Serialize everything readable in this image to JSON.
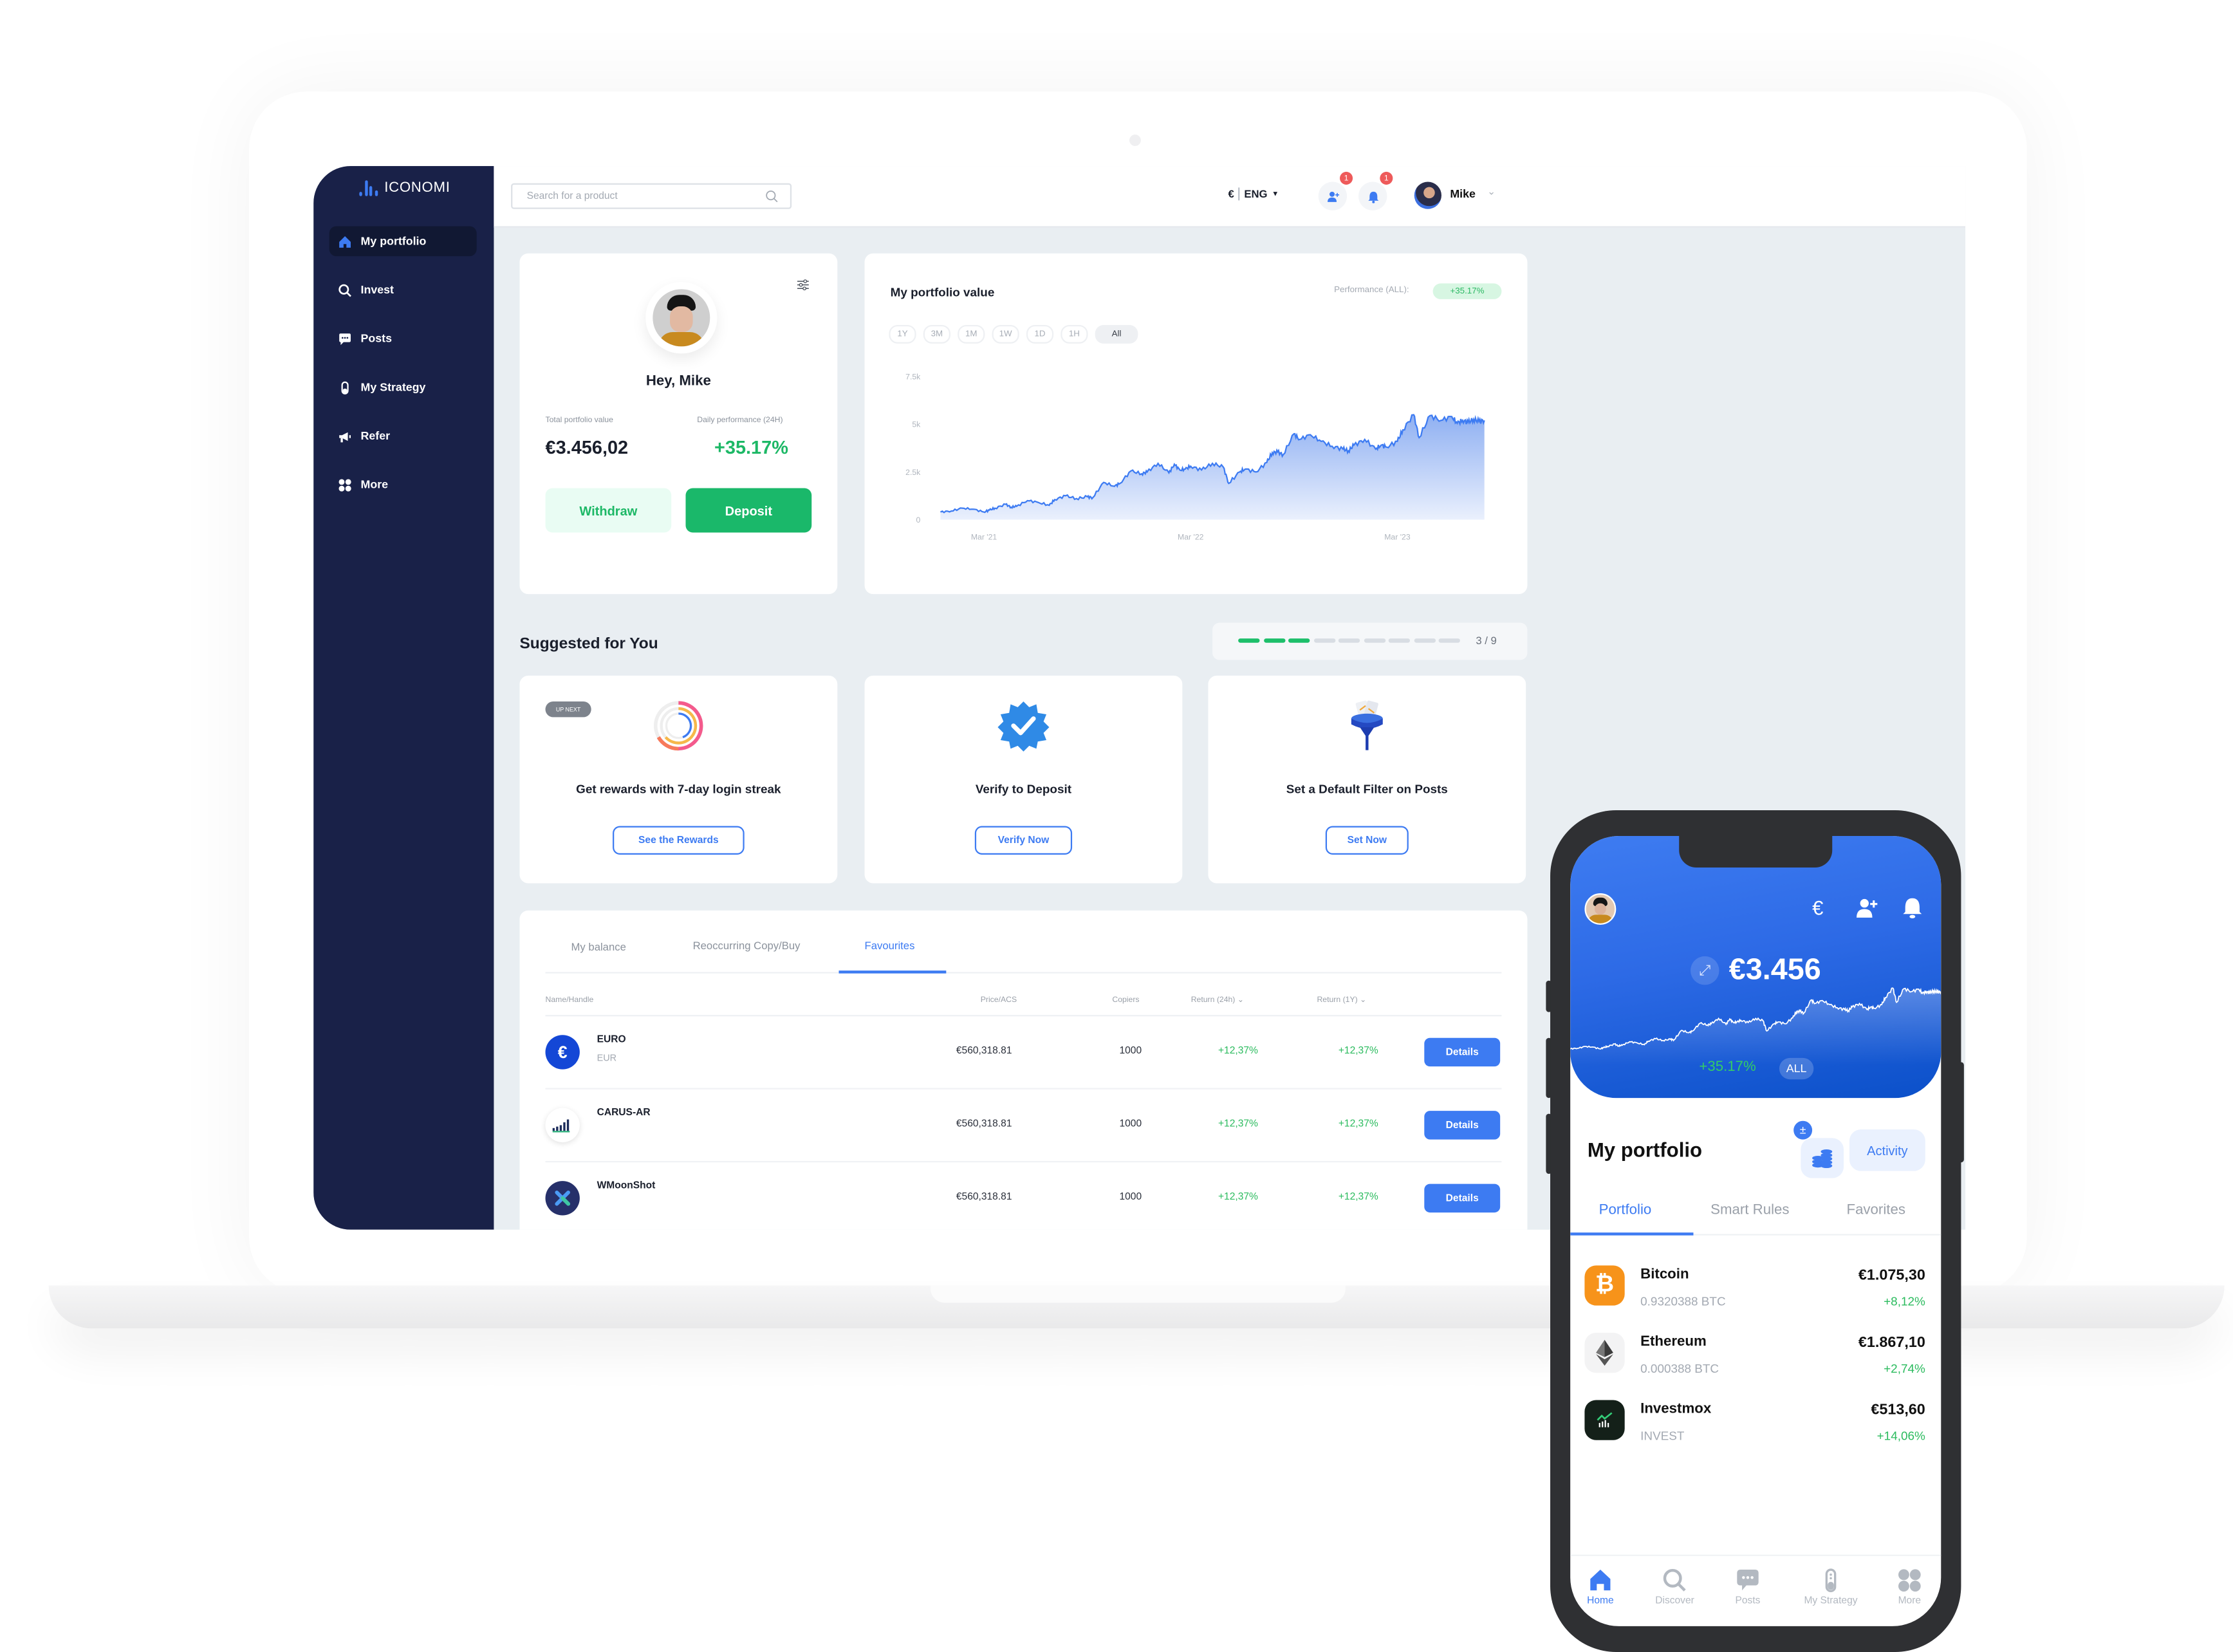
{
  "app": {
    "brand": "ICONOMI",
    "colors": {
      "primary": "#3d7bf2",
      "sidebar": "#192148",
      "success": "#1ab86a",
      "danger": "#ee5a5a",
      "background": "#e9eef2"
    }
  },
  "sidebar": {
    "items": [
      {
        "label": "My portfolio",
        "icon": "home-icon",
        "active": true
      },
      {
        "label": "Invest",
        "icon": "search-icon",
        "active": false
      },
      {
        "label": "Posts",
        "icon": "chat-icon",
        "active": false
      },
      {
        "label": "My Strategy",
        "icon": "flask-icon",
        "active": false
      },
      {
        "label": "Refer",
        "icon": "megaphone-icon",
        "active": false
      },
      {
        "label": "More",
        "icon": "grid-icon",
        "active": false
      }
    ]
  },
  "topbar": {
    "search_placeholder": "Search for a product",
    "currency": "€",
    "language": "ENG",
    "invites_badge": "1",
    "notifications_badge": "1",
    "user_name": "Mike"
  },
  "profile": {
    "greeting": "Hey, Mike",
    "total_label": "Total portfolio value",
    "total_value": "€3.456,02",
    "daily_label": "Daily performance (24H)",
    "daily_value": "+35.17%",
    "withdraw_label": "Withdraw",
    "deposit_label": "Deposit"
  },
  "portfolio_chart": {
    "title": "My portfolio value",
    "performance_label": "Performance (ALL):",
    "performance_value": "+35.17%",
    "ranges": [
      "1Y",
      "3M",
      "1M",
      "1W",
      "1D",
      "1H",
      "All"
    ],
    "active_range": "All"
  },
  "chart_data": {
    "type": "area",
    "title": "My portfolio value",
    "xlabel": "",
    "ylabel": "",
    "ylim": [
      0,
      7500
    ],
    "yticks": [
      "0",
      "2.5k",
      "5k",
      "7.5k"
    ],
    "ytick_values": [
      0,
      2500,
      5000,
      7500
    ],
    "xticks": [
      "Mar '21",
      "Mar '22",
      "Mar '23"
    ],
    "xtick_positions": [
      0.08,
      0.46,
      0.84
    ],
    "grid": false,
    "series": [
      {
        "name": "Portfolio value",
        "x": [
          0,
          0.02,
          0.04,
          0.06,
          0.08,
          0.09,
          0.1,
          0.12,
          0.13,
          0.14,
          0.16,
          0.18,
          0.2,
          0.21,
          0.23,
          0.25,
          0.27,
          0.28,
          0.3,
          0.32,
          0.33,
          0.35,
          0.37,
          0.38,
          0.4,
          0.42,
          0.43,
          0.44,
          0.45,
          0.46,
          0.48,
          0.5,
          0.52,
          0.53,
          0.55,
          0.56,
          0.58,
          0.6,
          0.61,
          0.62,
          0.63,
          0.65,
          0.66,
          0.68,
          0.7,
          0.72,
          0.74,
          0.75,
          0.76,
          0.78,
          0.8,
          0.81,
          0.82,
          0.84,
          0.85,
          0.87,
          0.88,
          0.9,
          0.92,
          0.94,
          0.95,
          0.96,
          0.97,
          0.98,
          0.99,
          1.0
        ],
        "values": [
          400,
          450,
          600,
          550,
          400,
          500,
          600,
          800,
          650,
          700,
          1000,
          900,
          750,
          1050,
          1250,
          1100,
          1200,
          1150,
          1950,
          1750,
          1900,
          2550,
          2400,
          2500,
          2950,
          2450,
          2900,
          2600,
          2650,
          2800,
          2600,
          2950,
          2750,
          1900,
          2500,
          2650,
          2500,
          3000,
          3500,
          3550,
          3400,
          4500,
          4200,
          4450,
          4100,
          3850,
          3700,
          3600,
          3900,
          4200,
          3700,
          3900,
          3800,
          4100,
          4700,
          5500,
          4300,
          5450,
          5200,
          5400,
          5050,
          5200,
          5100,
          5250,
          5150,
          5200
        ]
      }
    ]
  },
  "suggested": {
    "title": "Suggested for You",
    "progress_done": 3,
    "progress_total": 9,
    "progress_label": "3 / 9",
    "cards": [
      {
        "badge": "UP NEXT",
        "title": "Get rewards with 7-day login streak",
        "action": "See the Rewards",
        "icon": "streak-rings-icon"
      },
      {
        "title": "Verify to Deposit",
        "action": "Verify Now",
        "icon": "verified-badge-icon"
      },
      {
        "title": "Set a Default Filter on Posts",
        "action": "Set Now",
        "icon": "filter-funnel-icon"
      }
    ]
  },
  "holdings_table": {
    "tabs": [
      "My balance",
      "Reoccurring Copy/Buy",
      "Favourites"
    ],
    "active_tab": "Favourites",
    "columns": [
      "Name/Handle",
      "Price/ACS",
      "Copiers",
      "Return (24h)",
      "Return (1Y)"
    ],
    "rows": [
      {
        "name": "EURO",
        "handle": "EUR",
        "price": "€560,318.81",
        "copiers": "1000",
        "return_24h": "+12,37%",
        "return_1y": "+12,37%",
        "action": "Details"
      },
      {
        "name": "CARUS-AR",
        "handle": "",
        "price": "€560,318.81",
        "copiers": "1000",
        "return_24h": "+12,37%",
        "return_1y": "+12,37%",
        "action": "Details"
      },
      {
        "name": "WMoonShot",
        "handle": "",
        "price": "€560,318.81",
        "copiers": "1000",
        "return_24h": "+12,37%",
        "return_1y": "+12,37%",
        "action": "Details"
      }
    ]
  },
  "mobile": {
    "balance": "€3.456",
    "performance": "+35.17%",
    "range": "ALL",
    "section_title": "My portfolio",
    "activity_label": "Activity",
    "plus_minus": "±",
    "tabs": [
      "Portfolio",
      "Smart Rules",
      "Favorites"
    ],
    "active_tab": "Portfolio",
    "assets": [
      {
        "name": "Bitcoin",
        "amount": "0.9320388 BTC",
        "value": "€1.075,30",
        "change": "+8,12%",
        "icon": "bitcoin-icon"
      },
      {
        "name": "Ethereum",
        "amount": "0.000388 BTC",
        "value": "€1.867,10",
        "change": "+2,74%",
        "icon": "ethereum-icon"
      },
      {
        "name": "Investmox",
        "amount": "INVEST",
        "value": "€513,60",
        "change": "+14,06%",
        "icon": "investmox-icon"
      }
    ],
    "nav": [
      {
        "label": "Home",
        "active": true
      },
      {
        "label": "Discover",
        "active": false
      },
      {
        "label": "Posts",
        "active": false
      },
      {
        "label": "My Strategy",
        "active": false
      },
      {
        "label": "More",
        "active": false
      }
    ]
  }
}
